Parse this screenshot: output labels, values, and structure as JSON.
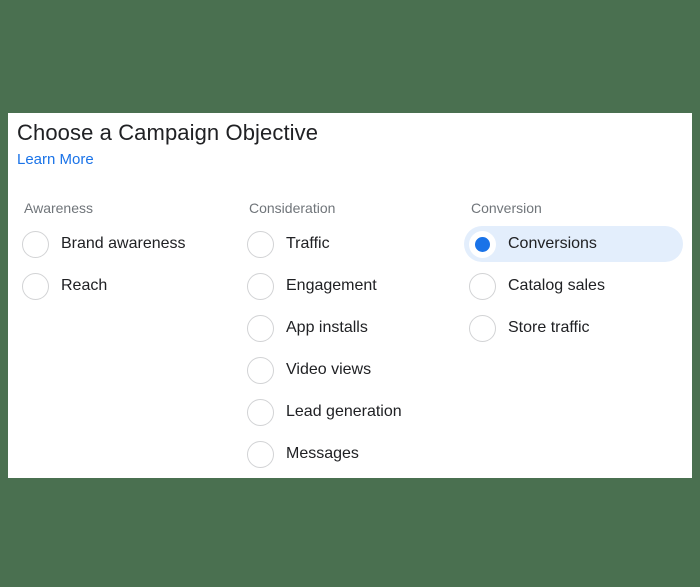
{
  "theme": {
    "page_background": "#4a7050",
    "card_background": "#ffffff",
    "title_color": "#202124",
    "link_color": "#1a73e8",
    "header_color": "#70757a",
    "label_color": "#202124",
    "selected_row_background": "#e3eefc",
    "radio_selected_color": "#1a73e8",
    "radio_border_color": "#d2d3d5"
  },
  "card": {
    "title": "Choose a Campaign Objective",
    "learn_more_label": "Learn More"
  },
  "columns": [
    {
      "header": "Awareness",
      "options": [
        {
          "label": "Brand awareness",
          "selected": false
        },
        {
          "label": "Reach",
          "selected": false
        }
      ]
    },
    {
      "header": "Consideration",
      "options": [
        {
          "label": "Traffic",
          "selected": false
        },
        {
          "label": "Engagement",
          "selected": false
        },
        {
          "label": "App installs",
          "selected": false
        },
        {
          "label": "Video views",
          "selected": false
        },
        {
          "label": "Lead generation",
          "selected": false
        },
        {
          "label": "Messages",
          "selected": false
        }
      ]
    },
    {
      "header": "Conversion",
      "options": [
        {
          "label": "Conversions",
          "selected": true
        },
        {
          "label": "Catalog sales",
          "selected": false
        },
        {
          "label": "Store traffic",
          "selected": false
        }
      ]
    }
  ]
}
